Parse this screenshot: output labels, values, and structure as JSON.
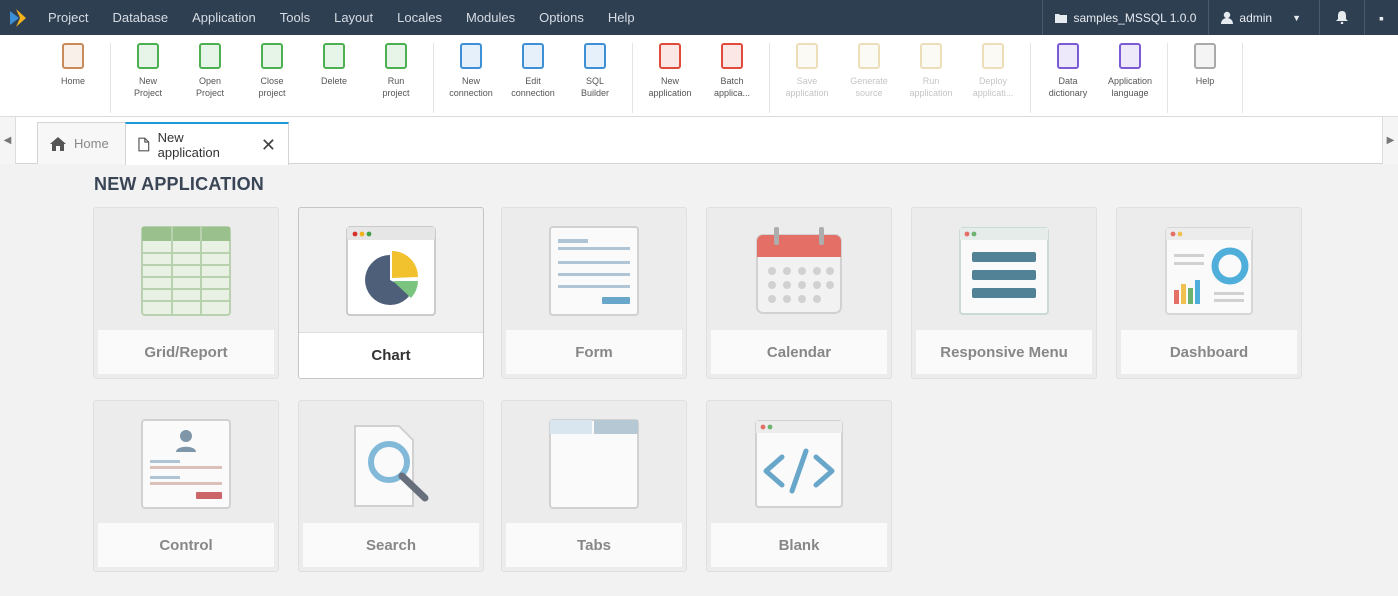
{
  "menubar": {
    "items": [
      "Project",
      "Database",
      "Application",
      "Tools",
      "Layout",
      "Locales",
      "Modules",
      "Options",
      "Help"
    ],
    "project_name": "samples_MSSQL 1.0.0",
    "user": "admin"
  },
  "toolbar": {
    "groups": [
      [
        {
          "label": "Home",
          "color": "#c98b5a"
        }
      ],
      [
        {
          "label": "New\nProject",
          "color": "#4caf50"
        },
        {
          "label": "Open\nProject",
          "color": "#4caf50"
        },
        {
          "label": "Close\nproject",
          "color": "#4caf50"
        },
        {
          "label": "Delete",
          "color": "#4caf50"
        },
        {
          "label": "Run\nproject",
          "color": "#4caf50"
        }
      ],
      [
        {
          "label": "New\nconnection",
          "color": "#3d8fd6"
        },
        {
          "label": "Edit\nconnection",
          "color": "#3d8fd6"
        },
        {
          "label": "SQL\nBuilder",
          "color": "#3d8fd6"
        }
      ],
      [
        {
          "label": "New\napplication",
          "color": "#e04a3a"
        },
        {
          "label": "Batch\napplica...",
          "color": "#e04a3a"
        }
      ],
      [
        {
          "label": "Save\napplication",
          "color": "#c8a23a",
          "disabled": true
        },
        {
          "label": "Generate\nsource",
          "color": "#c8a23a",
          "disabled": true
        },
        {
          "label": "Run\napplication",
          "color": "#c8a23a",
          "disabled": true
        },
        {
          "label": "Deploy\napplicati...",
          "color": "#c8a23a",
          "disabled": true
        }
      ],
      [
        {
          "label": "Data\ndictionary",
          "color": "#7b5ad6"
        },
        {
          "label": "Application\nlanguage",
          "color": "#7b5ad6"
        }
      ],
      [
        {
          "label": "Help",
          "color": "#aaaaaa"
        }
      ]
    ]
  },
  "tabs": {
    "home_label": "Home",
    "active_label": "New application"
  },
  "page": {
    "title": "NEW APPLICATION"
  },
  "cards": [
    {
      "label": "Grid/Report"
    },
    {
      "label": "Chart"
    },
    {
      "label": "Form"
    },
    {
      "label": "Calendar"
    },
    {
      "label": "Responsive Menu"
    },
    {
      "label": "Dashboard"
    },
    {
      "label": "Control"
    },
    {
      "label": "Search"
    },
    {
      "label": "Tabs"
    },
    {
      "label": "Blank"
    }
  ]
}
